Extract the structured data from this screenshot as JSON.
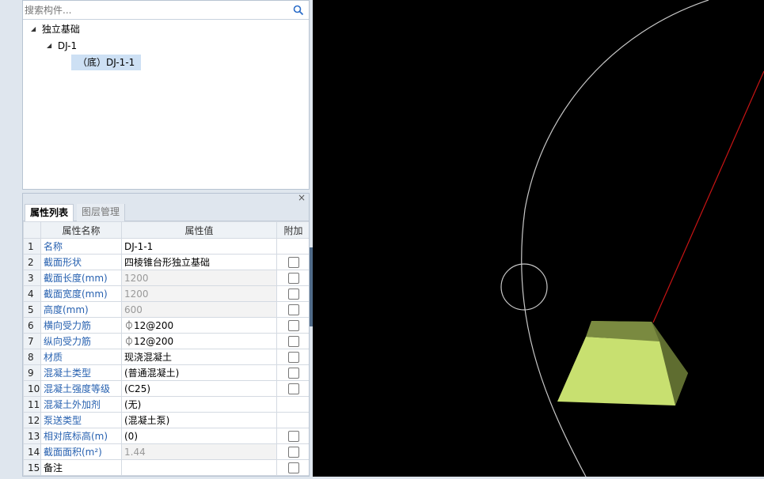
{
  "search": {
    "placeholder": "搜索构件..."
  },
  "tree": {
    "root": "独立基础",
    "child": "DJ-1",
    "selected": "（底）DJ-1-1"
  },
  "tabs": {
    "properties": "属性列表",
    "layers": "图层管理"
  },
  "close_symbol": "×",
  "table": {
    "headers": {
      "name": "属性名称",
      "value": "属性值",
      "extra": "附加"
    },
    "rows": [
      {
        "num": "1",
        "name": "名称",
        "value": "DJ-1-1",
        "name_color": "blue",
        "value_grey": false,
        "checkbox": false
      },
      {
        "num": "2",
        "name": "截面形状",
        "value": "四棱锥台形独立基础",
        "name_color": "blue",
        "value_grey": false,
        "checkbox": true
      },
      {
        "num": "3",
        "name": "截面长度(mm)",
        "value": "1200",
        "name_color": "blue",
        "value_grey": true,
        "checkbox": true
      },
      {
        "num": "4",
        "name": "截面宽度(mm)",
        "value": "1200",
        "name_color": "blue",
        "value_grey": true,
        "checkbox": true
      },
      {
        "num": "5",
        "name": "高度(mm)",
        "value": "600",
        "name_color": "blue",
        "value_grey": true,
        "checkbox": true
      },
      {
        "num": "6",
        "name": "横向受力筋",
        "value": "⏀12@200",
        "name_color": "blue",
        "value_grey": false,
        "checkbox": true
      },
      {
        "num": "7",
        "name": "纵向受力筋",
        "value": "⏀12@200",
        "name_color": "blue",
        "value_grey": false,
        "checkbox": true
      },
      {
        "num": "8",
        "name": "材质",
        "value": "现浇混凝土",
        "name_color": "blue",
        "value_grey": false,
        "checkbox": true
      },
      {
        "num": "9",
        "name": "混凝土类型",
        "value": "(普通混凝土)",
        "name_color": "blue",
        "value_grey": false,
        "checkbox": true
      },
      {
        "num": "10",
        "name": "混凝土强度等级",
        "value": "(C25)",
        "name_color": "blue",
        "value_grey": false,
        "checkbox": true
      },
      {
        "num": "11",
        "name": "混凝土外加剂",
        "value": "(无)",
        "name_color": "blue",
        "value_grey": false,
        "checkbox": false
      },
      {
        "num": "12",
        "name": "泵送类型",
        "value": "(混凝土泵)",
        "name_color": "blue",
        "value_grey": false,
        "checkbox": false
      },
      {
        "num": "13",
        "name": "相对底标高(m)",
        "value": "(0)",
        "name_color": "blue",
        "value_grey": false,
        "checkbox": true
      },
      {
        "num": "14",
        "name": "截面面积(m²)",
        "value": "1.44",
        "name_color": "blue",
        "value_grey": true,
        "checkbox": true
      },
      {
        "num": "15",
        "name": "备注",
        "value": "",
        "name_color": "black",
        "value_grey": false,
        "checkbox": true
      }
    ]
  },
  "viewport": {
    "background": "#000000",
    "arc_color": "#c8c8c8",
    "axis_color": "#c81414",
    "footing_top_color": "#c8e070",
    "footing_side_color": "#6c7a3a"
  }
}
